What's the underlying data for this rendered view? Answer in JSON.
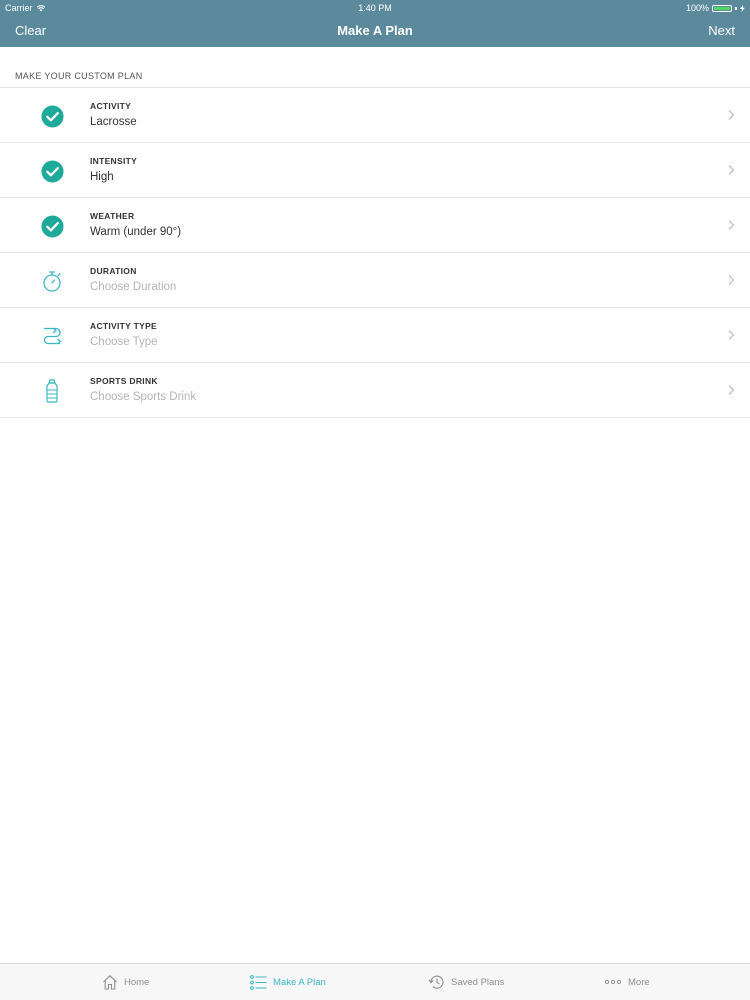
{
  "status_bar": {
    "carrier": "Carrier",
    "time": "1:40 PM",
    "battery": "100%"
  },
  "nav": {
    "left_label": "Clear",
    "title": "Make A Plan",
    "right_label": "Next"
  },
  "section": {
    "header": "MAKE YOUR CUSTOM PLAN"
  },
  "rows": [
    {
      "label": "ACTIVITY",
      "value": "Lacrosse",
      "icon": "check-circle-icon"
    },
    {
      "label": "INTENSITY",
      "value": "High",
      "icon": "check-circle-icon"
    },
    {
      "label": "WEATHER",
      "value": "Warm (under 90°)",
      "icon": "check-circle-icon"
    },
    {
      "label": "DURATION",
      "value": "Choose Duration",
      "icon": "stopwatch-icon"
    },
    {
      "label": "ACTIVITY TYPE",
      "value": "Choose Type",
      "icon": "route-icon"
    },
    {
      "label": "SPORTS DRINK",
      "value": "Choose Sports Drink",
      "icon": "bottle-icon"
    }
  ],
  "tabs": [
    {
      "label": "Home",
      "icon": "home-icon"
    },
    {
      "label": "Make A Plan",
      "icon": "list-icon",
      "active": true
    },
    {
      "label": "Saved Plans",
      "icon": "history-icon"
    },
    {
      "label": "More",
      "icon": "more-dots-icon"
    }
  ],
  "colors": {
    "nav_background": "#5b8a9d",
    "accent": "#3bb7c6",
    "check_fill": "#1fa99a",
    "placeholder": "#b5b5b5",
    "battery": "#4cd964"
  }
}
